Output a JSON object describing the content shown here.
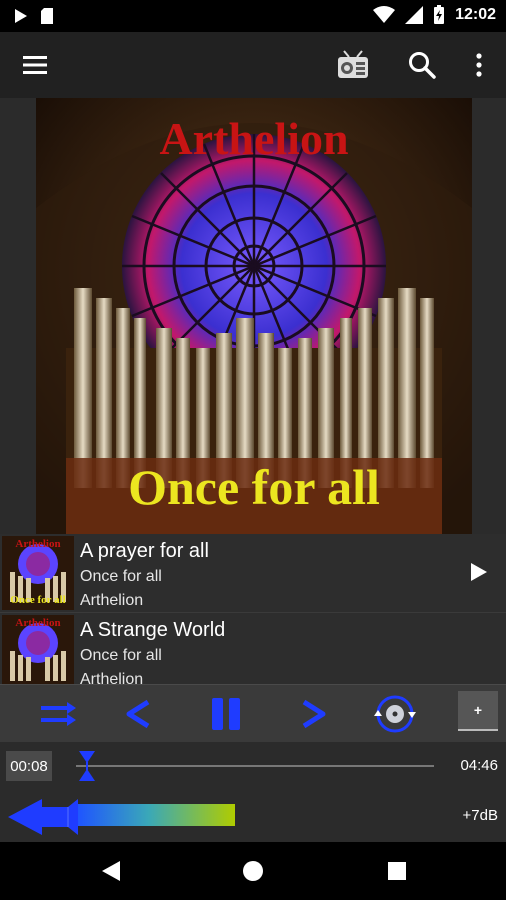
{
  "status": {
    "time": "12:02"
  },
  "album": {
    "artist": "Arthelion",
    "title": "Once for all"
  },
  "tracks": [
    {
      "title": "A prayer for all",
      "album": "Once for all",
      "artist": "Arthelion"
    },
    {
      "title": "A Strange World",
      "album": "Once for all",
      "artist": "Arthelion"
    }
  ],
  "player": {
    "current_time": "00:08",
    "total_time": "04:46",
    "progress": 0.03,
    "volume_db": "+7dB",
    "plus_label": "+"
  },
  "thumb": {
    "artist": "Arthelion",
    "title": "Once for all"
  },
  "colors": {
    "accent": "#1f3cff",
    "toolbar": "#212121",
    "background": "#2b2b2b"
  }
}
